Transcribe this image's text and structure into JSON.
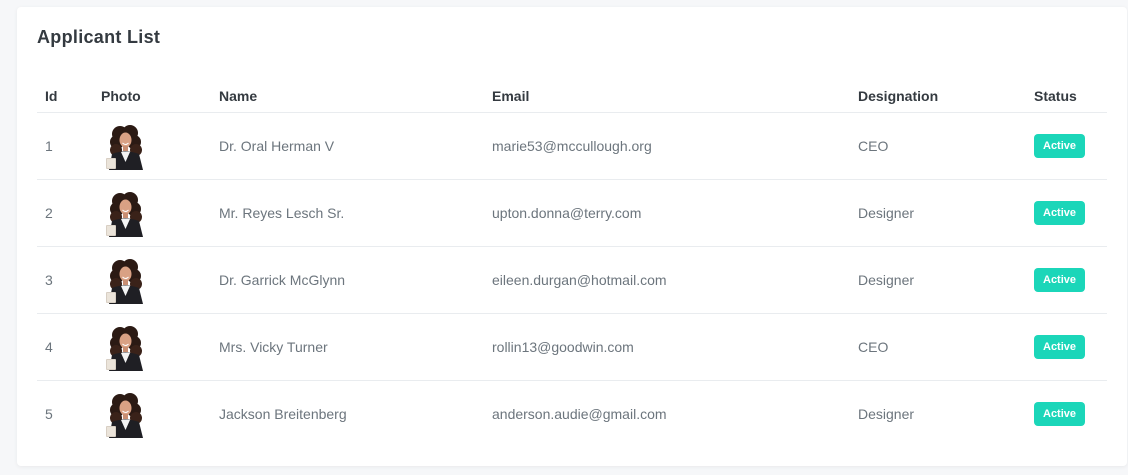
{
  "card": {
    "title": "Applicant List"
  },
  "table": {
    "headers": {
      "id": "Id",
      "photo": "Photo",
      "name": "Name",
      "email": "Email",
      "designation": "Designation",
      "status": "Status"
    },
    "rows": [
      {
        "id": "1",
        "name": "Dr. Oral Herman V",
        "email": "marie53@mccullough.org",
        "designation": "CEO",
        "status": "Active",
        "photo_icon": "avatar-woman"
      },
      {
        "id": "2",
        "name": "Mr. Reyes Lesch Sr.",
        "email": "upton.donna@terry.com",
        "designation": "Designer",
        "status": "Active",
        "photo_icon": "avatar-woman"
      },
      {
        "id": "3",
        "name": "Dr. Garrick McGlynn",
        "email": "eileen.durgan@hotmail.com",
        "designation": "Designer",
        "status": "Active",
        "photo_icon": "avatar-woman"
      },
      {
        "id": "4",
        "name": "Mrs. Vicky Turner",
        "email": "rollin13@goodwin.com",
        "designation": "CEO",
        "status": "Active",
        "photo_icon": "avatar-woman"
      },
      {
        "id": "5",
        "name": "Jackson Breitenberg",
        "email": "anderson.audie@gmail.com",
        "designation": "Designer",
        "status": "Active",
        "photo_icon": "avatar-woman"
      }
    ]
  },
  "colors": {
    "status_active": "#1bd6b9",
    "heading_text": "#343a40",
    "body_text": "#6c757d"
  }
}
